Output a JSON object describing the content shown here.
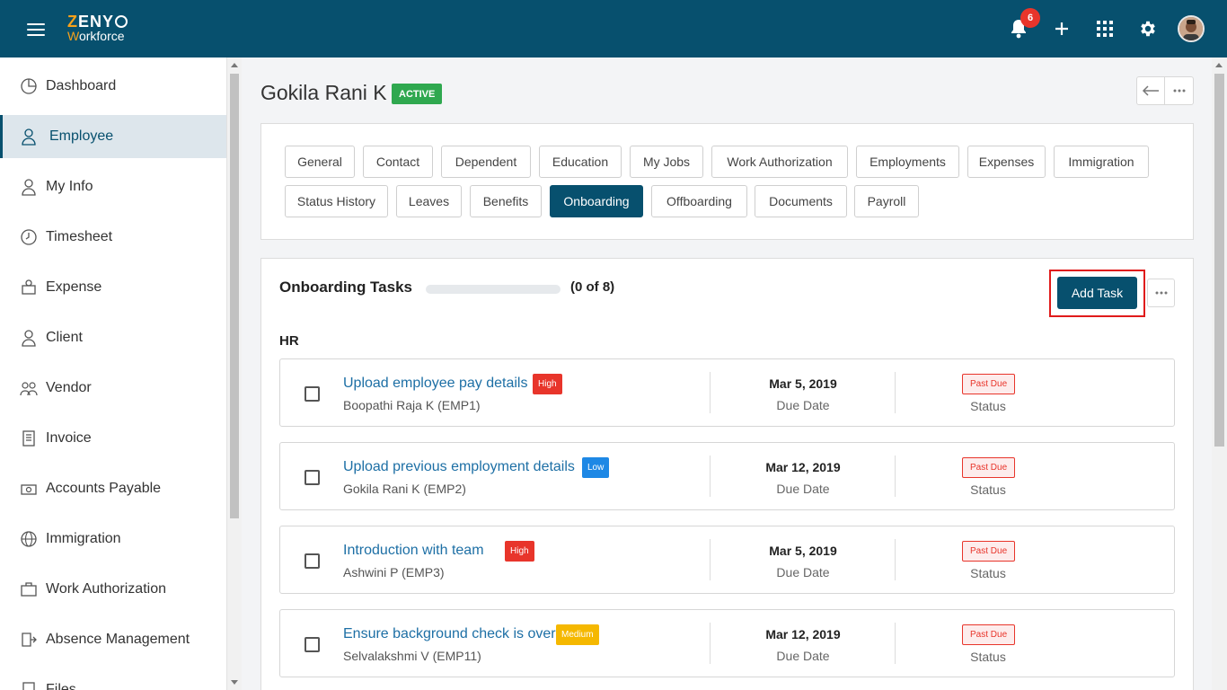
{
  "app": {
    "logo_line1_prefix": "Z",
    "logo_line1_rest": "ENY",
    "logo_line2_prefix": "W",
    "logo_line2_rest": "orkforce",
    "notification_count": "6"
  },
  "sidebar": {
    "items": [
      {
        "label": "Dashboard",
        "icon": "dashboard-icon"
      },
      {
        "label": "Employee",
        "icon": "employee-icon",
        "active": true
      },
      {
        "label": "My Info",
        "icon": "my-info-icon"
      },
      {
        "label": "Timesheet",
        "icon": "clock-icon"
      },
      {
        "label": "Expense",
        "icon": "expense-icon"
      },
      {
        "label": "Client",
        "icon": "client-icon"
      },
      {
        "label": "Vendor",
        "icon": "vendor-icon"
      },
      {
        "label": "Invoice",
        "icon": "invoice-icon"
      },
      {
        "label": "Accounts Payable",
        "icon": "accounts-payable-icon"
      },
      {
        "label": "Immigration",
        "icon": "globe-icon"
      },
      {
        "label": "Work Authorization",
        "icon": "briefcase-icon"
      },
      {
        "label": "Absence Management",
        "icon": "absence-icon"
      },
      {
        "label": "Files",
        "icon": "files-icon"
      }
    ]
  },
  "employee": {
    "name": "Gokila Rani K",
    "status": "ACTIVE"
  },
  "tabs": [
    "General",
    "Contact",
    "Dependent",
    "Education",
    "My Jobs",
    "Work Authorization",
    "Employments",
    "Expenses",
    "Immigration",
    "Status History",
    "Leaves",
    "Benefits",
    "Onboarding",
    "Offboarding",
    "Documents",
    "Payroll"
  ],
  "active_tab": "Onboarding",
  "onboarding": {
    "title": "Onboarding Tasks",
    "progress_text": "(0 of 8)",
    "progress_fraction": 0,
    "add_task_label": "Add Task",
    "group_label": "HR",
    "due_label": "Due Date",
    "status_label": "Status",
    "tasks": [
      {
        "name": "Upload employee pay details",
        "priority": "High",
        "assignee": "Boopathi Raja K (EMP1)",
        "due": "Mar 5, 2019",
        "status": "Past Due"
      },
      {
        "name": "Upload previous employment details",
        "priority": "Low",
        "assignee": "Gokila Rani K (EMP2)",
        "due": "Mar 12, 2019",
        "status": "Past Due"
      },
      {
        "name": "Introduction with team",
        "priority": "High",
        "assignee": "Ashwini P (EMP3)",
        "due": "Mar 5, 2019",
        "status": "Past Due"
      },
      {
        "name": "Ensure background check is over",
        "priority": "Medium",
        "assignee": "Selvalakshmi V (EMP11)",
        "due": "Mar 12, 2019",
        "status": "Past Due"
      }
    ]
  },
  "colors": {
    "brand": "#07506e",
    "accent": "#f7a21b",
    "active_green": "#2fa84f",
    "high": "#e8352b",
    "low": "#1e88e5",
    "medium": "#f5b800"
  }
}
